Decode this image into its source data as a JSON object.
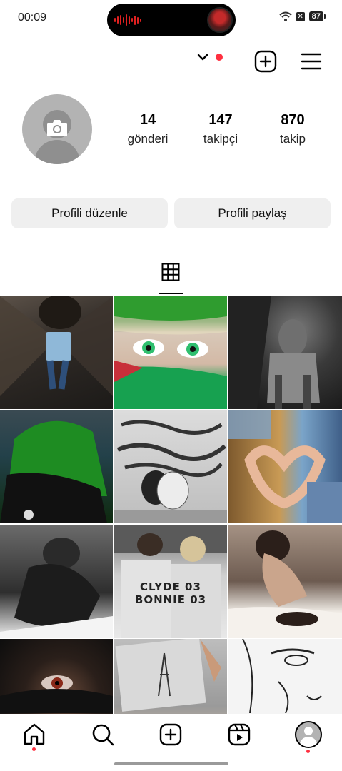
{
  "status_bar": {
    "time": "00:09",
    "battery": "87"
  },
  "profile": {
    "stats": [
      {
        "value": "14",
        "label": "gönderi"
      },
      {
        "value": "147",
        "label": "takipçi"
      },
      {
        "value": "870",
        "label": "takip"
      }
    ]
  },
  "buttons": {
    "edit": "Profili düzenle",
    "share": "Profili paylaş"
  },
  "grid": {
    "tiles": [
      {
        "caption": ""
      },
      {
        "caption": ""
      },
      {
        "caption": ""
      },
      {
        "caption": ""
      },
      {
        "caption": ""
      },
      {
        "caption": ""
      },
      {
        "caption": ""
      },
      {
        "caption": "CLYDE 03   BONNIE 03"
      },
      {
        "caption": ""
      },
      {
        "caption": ""
      },
      {
        "caption": ""
      },
      {
        "caption": ""
      }
    ]
  },
  "colors": {
    "accent_red": "#ff3040",
    "button_bg": "#efefef"
  },
  "icons": [
    "chevron-down-icon",
    "create-plus-icon",
    "menu-icon",
    "camera-icon",
    "grid-icon",
    "home-icon",
    "search-icon",
    "add-post-icon",
    "reels-icon",
    "profile-icon"
  ]
}
